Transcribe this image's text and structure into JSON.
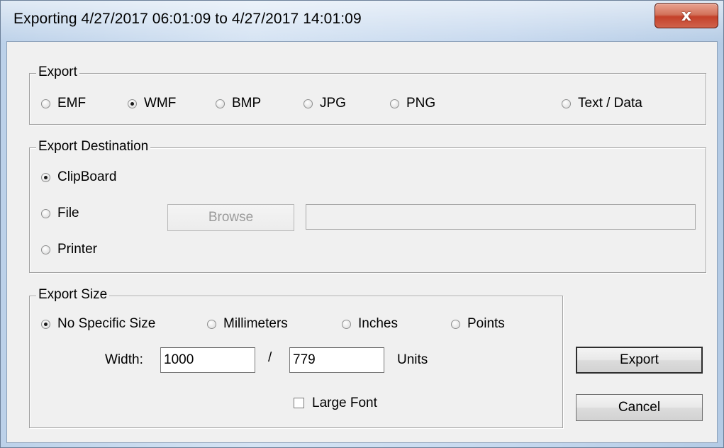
{
  "window": {
    "title": "Exporting 4/27/2017 06:01:09 to 4/27/2017 14:01:09",
    "close_glyph": "x"
  },
  "export_group": {
    "label": "Export",
    "formats": [
      {
        "label": "EMF",
        "checked": false
      },
      {
        "label": "WMF",
        "checked": true
      },
      {
        "label": "BMP",
        "checked": false
      },
      {
        "label": "JPG",
        "checked": false
      },
      {
        "label": "PNG",
        "checked": false
      },
      {
        "label": "Text / Data",
        "checked": false
      }
    ]
  },
  "destination_group": {
    "label": "Export Destination",
    "options": [
      {
        "label": "ClipBoard",
        "checked": true
      },
      {
        "label": "File",
        "checked": false
      },
      {
        "label": "Printer",
        "checked": false
      }
    ],
    "browse_label": "Browse",
    "file_path": ""
  },
  "size_group": {
    "label": "Export Size",
    "units": [
      {
        "label": "No Specific Size",
        "checked": true
      },
      {
        "label": "Millimeters",
        "checked": false
      },
      {
        "label": "Inches",
        "checked": false
      },
      {
        "label": "Points",
        "checked": false
      }
    ],
    "width_label": "Width:",
    "width_value": "1000",
    "separator": "/",
    "height_value": "779",
    "units_label": "Units",
    "large_font_label": "Large Font",
    "large_font_checked": false
  },
  "buttons": {
    "export_label": "Export",
    "cancel_label": "Cancel"
  }
}
